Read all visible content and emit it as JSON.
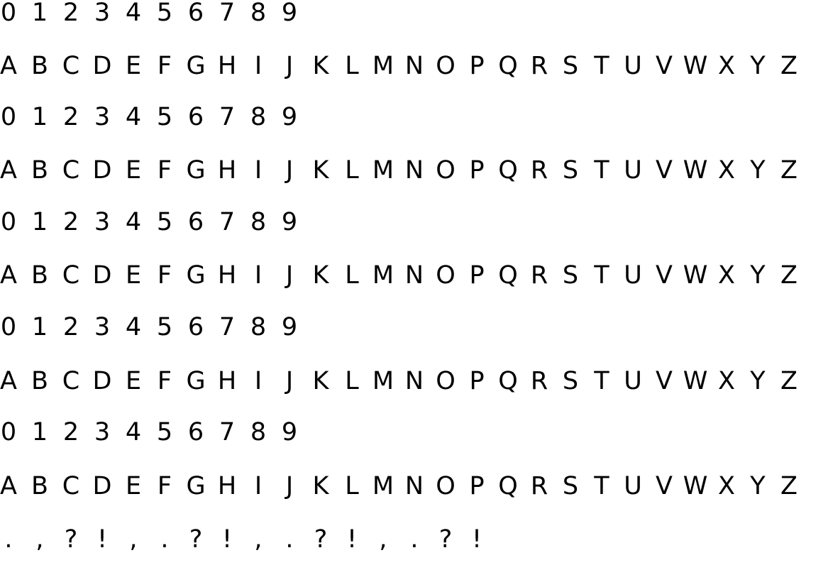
{
  "rows": [
    [
      "0",
      "1",
      "2",
      "3",
      "4",
      "5",
      "6",
      "7",
      "8",
      "9"
    ],
    [
      "A",
      "B",
      "C",
      "D",
      "E",
      "F",
      "G",
      "H",
      "I",
      "J",
      "K",
      "L",
      "M",
      "N",
      "O",
      "P",
      "Q",
      "R",
      "S",
      "T",
      "U",
      "V",
      "W",
      "X",
      "Y",
      "Z"
    ],
    [
      "0",
      "1",
      "2",
      "3",
      "4",
      "5",
      "6",
      "7",
      "8",
      "9"
    ],
    [
      "A",
      "B",
      "C",
      "D",
      "E",
      "F",
      "G",
      "H",
      "I",
      "J",
      "K",
      "L",
      "M",
      "N",
      "O",
      "P",
      "Q",
      "R",
      "S",
      "T",
      "U",
      "V",
      "W",
      "X",
      "Y",
      "Z"
    ],
    [
      "0",
      "1",
      "2",
      "3",
      "4",
      "5",
      "6",
      "7",
      "8",
      "9"
    ],
    [
      "A",
      "B",
      "C",
      "D",
      "E",
      "F",
      "G",
      "H",
      "I",
      "J",
      "K",
      "L",
      "M",
      "N",
      "O",
      "P",
      "Q",
      "R",
      "S",
      "T",
      "U",
      "V",
      "W",
      "X",
      "Y",
      "Z"
    ],
    [
      "0",
      "1",
      "2",
      "3",
      "4",
      "5",
      "6",
      "7",
      "8",
      "9"
    ],
    [
      "A",
      "B",
      "C",
      "D",
      "E",
      "F",
      "G",
      "H",
      "I",
      "J",
      "K",
      "L",
      "M",
      "N",
      "O",
      "P",
      "Q",
      "R",
      "S",
      "T",
      "U",
      "V",
      "W",
      "X",
      "Y",
      "Z"
    ],
    [
      "0",
      "1",
      "2",
      "3",
      "4",
      "5",
      "6",
      "7",
      "8",
      "9"
    ],
    [
      "A",
      "B",
      "C",
      "D",
      "E",
      "F",
      "G",
      "H",
      "I",
      "J",
      "K",
      "L",
      "M",
      "N",
      "O",
      "P",
      "Q",
      "R",
      "S",
      "T",
      "U",
      "V",
      "W",
      "X",
      "Y",
      "Z"
    ],
    [
      ".",
      ",",
      "?",
      "!",
      ",",
      ".",
      "?",
      "!",
      ",",
      ".",
      "?",
      "!",
      ",",
      ".",
      "?",
      "!"
    ]
  ]
}
